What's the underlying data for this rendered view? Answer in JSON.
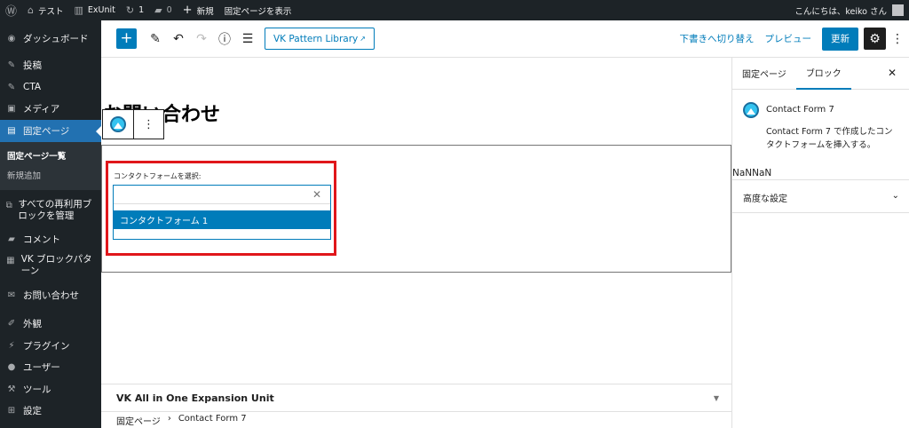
{
  "adminbar": {
    "site_name": "テスト",
    "theme_name": "ExUnit",
    "updates_count": "1",
    "comments_count": "0",
    "new_label": "新規",
    "view_page_label": "固定ページを表示",
    "greeting": "こんにちは、keiko さん"
  },
  "sidebar": {
    "dashboard": "ダッシュボード",
    "posts": "投稿",
    "cta": "CTA",
    "media": "メディア",
    "pages": "固定ページ",
    "pages_all": "固定ページ一覧",
    "pages_new": "新規追加",
    "reusable": "すべての再利用ブロックを管理",
    "comments": "コメント",
    "vk_patterns": "VK ブロックパターン",
    "contact": "お問い合わせ",
    "appearance": "外観",
    "plugins": "プラグイン",
    "users": "ユーザー",
    "tools": "ツール",
    "settings": "設定"
  },
  "header": {
    "vk_pattern_library": "VK Pattern Library",
    "switch_to_draft": "下書きへ切り替え",
    "preview": "プレビュー",
    "update": "更新"
  },
  "content": {
    "title": "お問い合わせ",
    "cf_label": "コンタクトフォームを選択:",
    "cf_input_value": "",
    "cf_option": "コンタクトフォーム 1",
    "meta_box_title": "VK All in One Expansion Unit",
    "breadcrumb": [
      "固定ページ",
      "Contact Form 7"
    ]
  },
  "panel": {
    "tab_page": "固定ページ",
    "tab_block": "ブロック",
    "block_title": "Contact Form 7",
    "block_desc": "Contact Form 7 で作成したコンタクトフォームを挿入する。",
    "nan_text": "NaNNaN",
    "advanced": "高度な設定"
  },
  "colors": {
    "accent": "#007cba",
    "admin_dark": "#1d2327",
    "highlight": "#e0161b"
  }
}
